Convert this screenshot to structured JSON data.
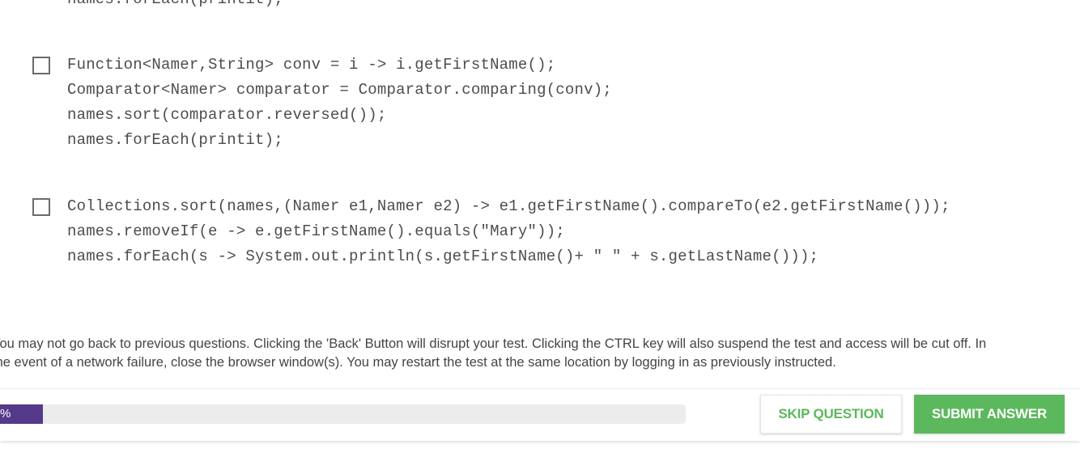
{
  "question": {
    "top_partial_line": "names.forEach(printit);",
    "options": [
      {
        "checked": false,
        "lines": [
          "Function<Namer,String> conv = i -> i.getFirstName();",
          "Comparator<Namer> comparator = Comparator.comparing(conv);",
          "names.sort(comparator.reversed());",
          "names.forEach(printit);"
        ]
      },
      {
        "checked": false,
        "lines": [
          "Collections.sort(names,(Namer e1,Namer e2) -> e1.getFirstName().compareTo(e2.getFirstName()));",
          "names.removeIf(e -> e.getFirstName().equals(\"Mary\"));",
          "names.forEach(s -> System.out.println(s.getFirstName()+ \" \" + s.getLastName()));"
        ]
      }
    ]
  },
  "notice": {
    "line1": "You may not go back to previous questions. Clicking the 'Back' Button will disrupt your test. Clicking the CTRL key will also suspend the test and access will be cut off. In",
    "line2": "the event of a network failure, close the browser window(s). You may restart the test at the same location by logging in as previously instructed."
  },
  "footer": {
    "progress": {
      "label": "%",
      "fill_color": "#55398a"
    },
    "skip_label": "SKIP QUESTION",
    "submit_label": "SUBMIT ANSWER",
    "accent_color": "#5cb85c"
  }
}
